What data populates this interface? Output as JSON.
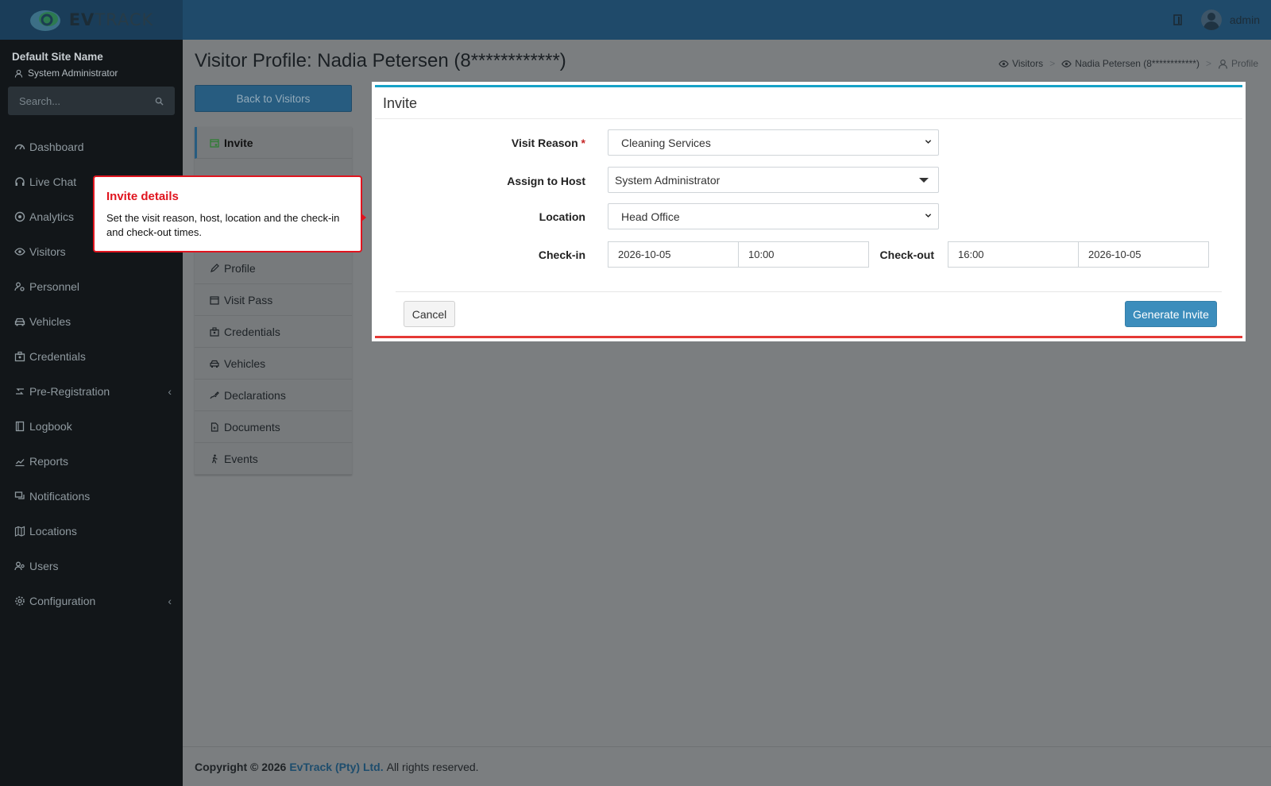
{
  "app": {
    "logo_text_bold": "EV",
    "logo_text": "TRACK",
    "user_name": "admin"
  },
  "sidebar": {
    "site_name": "Default Site Name",
    "site_user": "System Administrator",
    "search_placeholder": "Search...",
    "items": [
      {
        "label": "Dashboard",
        "icon": "dashboard-icon"
      },
      {
        "label": "Live Chat",
        "icon": "headset-icon"
      },
      {
        "label": "Analytics",
        "icon": "target-icon"
      },
      {
        "label": "Visitors",
        "icon": "eye-icon"
      },
      {
        "label": "Personnel",
        "icon": "user-gear-icon"
      },
      {
        "label": "Vehicles",
        "icon": "car-icon"
      },
      {
        "label": "Credentials",
        "icon": "id-badge-icon"
      },
      {
        "label": "Pre-Registration",
        "icon": "arrows-icon",
        "has_children": true
      },
      {
        "label": "Logbook",
        "icon": "book-icon"
      },
      {
        "label": "Reports",
        "icon": "chart-icon"
      },
      {
        "label": "Notifications",
        "icon": "chat-icon"
      },
      {
        "label": "Locations",
        "icon": "map-icon"
      },
      {
        "label": "Users",
        "icon": "users-icon"
      },
      {
        "label": "Configuration",
        "icon": "gear-icon",
        "has_children": true
      }
    ]
  },
  "page": {
    "title": "Visitor Profile: Nadia Petersen (8************)",
    "breadcrumb": {
      "visitors": "Visitors",
      "visitor": "Nadia Petersen (8************)",
      "current": "Profile",
      "separator": ">"
    },
    "back_button": "Back to Visitors"
  },
  "profile_menu": {
    "active": "Invite",
    "items": [
      "Profile",
      "Visit Pass",
      "Credentials",
      "Vehicles",
      "Declarations",
      "Documents",
      "Events"
    ]
  },
  "invite": {
    "title": "Invite",
    "visit_reason_label": "Visit Reason",
    "required_mark": "*",
    "visit_reason_value": "Cleaning Services",
    "host_label": "Assign to Host",
    "host_value": "System Administrator",
    "location_label": "Location",
    "location_value": "Head Office",
    "checkin_label": "Check-in",
    "checkin_date": "2026-10-05",
    "checkin_time": "10:00",
    "checkout_label": "Check-out",
    "checkout_time": "16:00",
    "checkout_date": "2026-10-05",
    "cancel_label": "Cancel",
    "generate_label": "Generate Invite"
  },
  "callout": {
    "title": "Invite details",
    "body": "Set the visit reason, host, location and the check-in and check-out times."
  },
  "footer": {
    "copyright": "Copyright © 2026",
    "company": "EvTrack (Pty) Ltd.",
    "rights": "All rights reserved."
  },
  "colors": {
    "topbar": "#1f4a6a",
    "sidebar": "#121619",
    "primary": "#3c8dbc",
    "card_top_border": "#17a2c7",
    "highlight": "#e0141e"
  }
}
